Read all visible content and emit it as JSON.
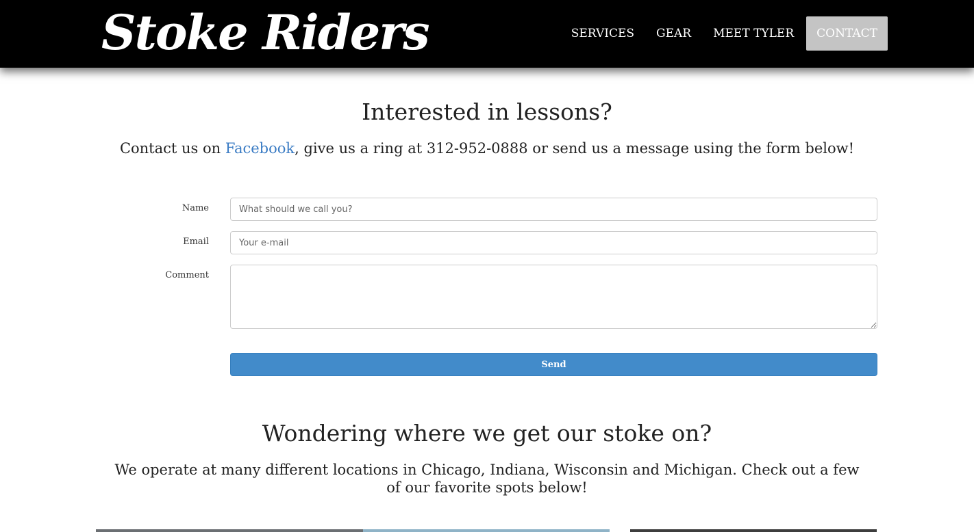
{
  "header": {
    "logo": "Stoke Riders",
    "nav": [
      "SERVICES",
      "GEAR",
      "MEET TYLER",
      "CONTACT"
    ]
  },
  "lessons": {
    "title": "Interested in lessons?",
    "intro_before": "Contact us on ",
    "facebook_link": "Facebook",
    "intro_middle": ", give us a ring at 312-952-0888 or send us a message using the form below!"
  },
  "form": {
    "name_label": "Name",
    "name_placeholder": "What should we call you?",
    "email_label": "Email",
    "email_placeholder": "Your e-mail",
    "comment_label": "Comment",
    "send_label": "Send"
  },
  "locations": {
    "title": "Wondering where we get our stoke on?",
    "text": "We operate at many different locations in Chicago, Indiana, Wisconsin and Michigan. Check out a few of our favorite spots below!"
  },
  "colors": {
    "link": "#3b7cc4",
    "button": "#428bca",
    "active_nav": "#c4c4c4"
  }
}
